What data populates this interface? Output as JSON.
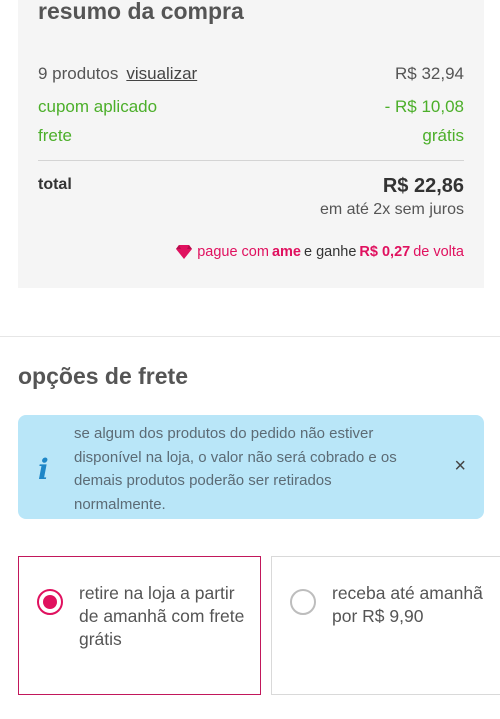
{
  "summary": {
    "title": "resumo da compra",
    "products_label": "9 produtos",
    "view_link": "visualizar",
    "products_value": "R$ 32,94",
    "coupon_label": "cupom aplicado",
    "coupon_value": "- R$ 10,08",
    "shipping_label": "frete",
    "shipping_value": "grátis",
    "total_label": "total",
    "total_value": "R$ 22,86",
    "installments": "em até 2x sem juros",
    "ame": {
      "prefix": "pague com",
      "brand": "ame",
      "middle": "e ganhe",
      "amount": "R$ 0,27",
      "suffix": "de volta"
    }
  },
  "shipping_options": {
    "title": "opções de frete",
    "info_icon": "i",
    "info_text": "se algum dos produtos do pedido não estiver disponível na loja, o valor não será cobrado e os demais produtos poderão ser retirados normalmente.",
    "close_icon": "×",
    "options": [
      {
        "label": "retire na loja a partir de amanhã com frete grátis",
        "selected": true
      },
      {
        "label": "receba até amanhã por R$ 9,90",
        "selected": false
      }
    ]
  },
  "colors": {
    "accent": "#e0115f",
    "success": "#4caf2a",
    "info_bg": "#b9e6f8",
    "info_icon": "#1d86c7",
    "card_bg": "#f5f5f5"
  }
}
